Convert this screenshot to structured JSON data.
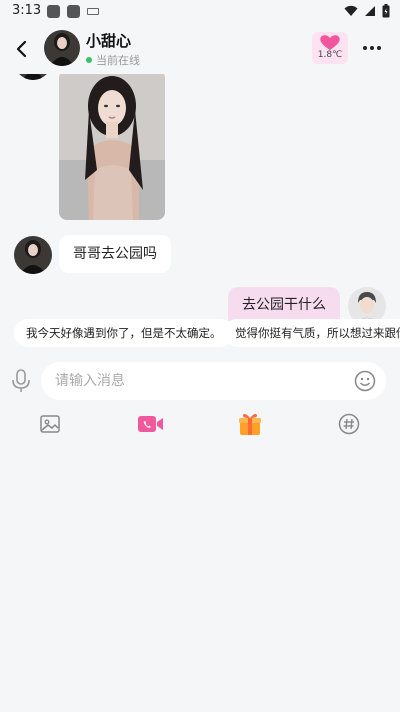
{
  "status_bar": {
    "time": "3:13"
  },
  "header": {
    "contact_name": "小甜心",
    "online_status": "当前在线",
    "temperature": "1.8℃"
  },
  "messages": [
    {
      "type": "image",
      "from": "contact"
    },
    {
      "type": "text",
      "from": "contact",
      "text": "哥哥去公园吗"
    },
    {
      "type": "text",
      "from": "me",
      "text": "去公园干什么"
    }
  ],
  "quick_replies": [
    "我今天好像遇到你了，但是不太确定。",
    "觉得你挺有气质，所以想过来跟你打"
  ],
  "composer": {
    "placeholder": "请输入消息"
  },
  "toolbar": {
    "icons": [
      "image-icon",
      "video-call-icon",
      "gift-icon",
      "topic-hashtag-icon"
    ]
  },
  "colors": {
    "background": "#f5f6f8",
    "outgoing_bubble": "#f7dcf0",
    "accent_pink": "#f0589e",
    "online_green": "#34c36b"
  }
}
